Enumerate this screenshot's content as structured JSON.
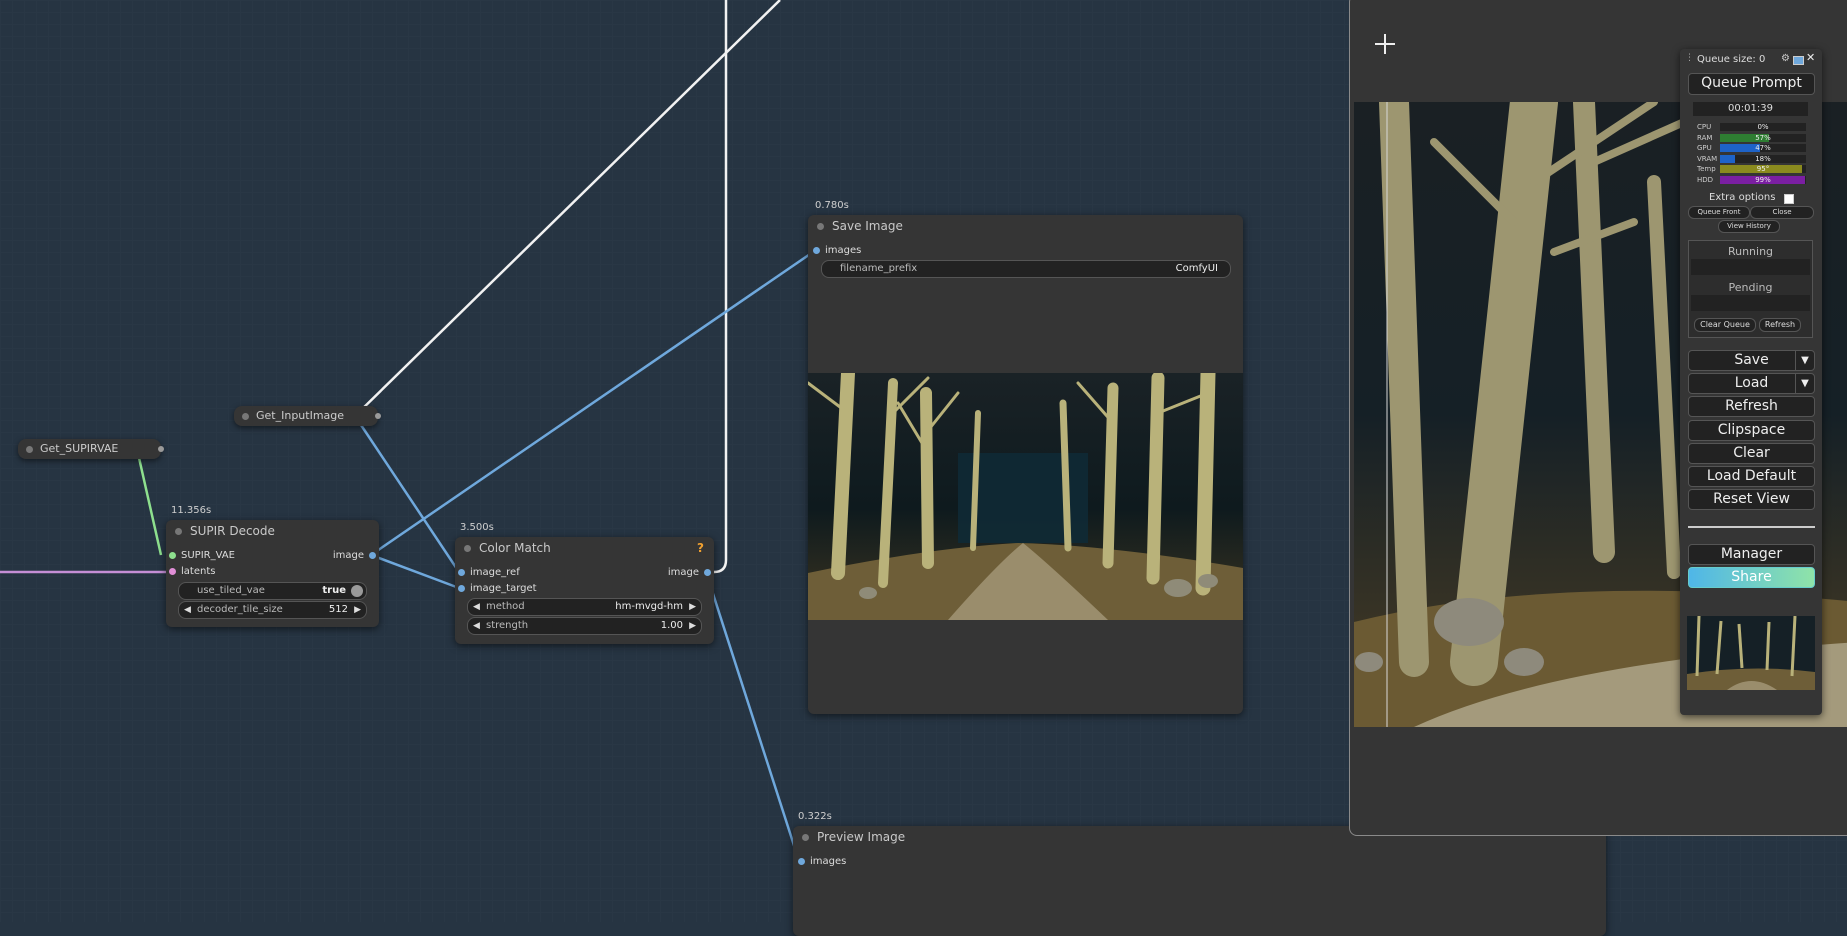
{
  "nodes": {
    "get_supirvae": {
      "title": "Get_SUPIRVAE"
    },
    "get_inputimage": {
      "title": "Get_InputImage"
    },
    "supir_decode": {
      "timing": "11.356s",
      "title": "SUPIR Decode",
      "inputs": [
        "SUPIR_VAE",
        "latents"
      ],
      "output": "image",
      "widgets": [
        {
          "label": "use_tiled_vae",
          "value": "true"
        },
        {
          "label": "decoder_tile_size",
          "value": "512"
        }
      ]
    },
    "color_match": {
      "timing": "3.500s",
      "title": "Color Match",
      "badge": "?",
      "inputs": [
        "image_ref",
        "image_target"
      ],
      "output": "image",
      "widgets": [
        {
          "label": "method",
          "value": "hm-mvgd-hm"
        },
        {
          "label": "strength",
          "value": "1.00"
        }
      ]
    },
    "save_image": {
      "timing": "0.780s",
      "title": "Save Image",
      "input": "images",
      "widget": {
        "label": "filename_prefix",
        "value": "ComfyUI"
      }
    },
    "preview_image": {
      "timing": "0.322s",
      "title": "Preview Image",
      "input": "images"
    }
  },
  "viewer": {
    "crosshair_icon": "crosshair-icon"
  },
  "panel": {
    "queue_size": "Queue size: 0",
    "queue_prompt": "Queue Prompt",
    "timer": "00:01:39",
    "monitors": [
      {
        "label": "CPU",
        "value": "0%",
        "fraction": 0.0,
        "color": "#2e7d32"
      },
      {
        "label": "RAM",
        "value": "57%",
        "fraction": 0.57,
        "color": "#2e7d32"
      },
      {
        "label": "GPU",
        "value": "47%",
        "fraction": 0.47,
        "color": "#1e63c8"
      },
      {
        "label": "VRAM",
        "value": "18%",
        "fraction": 0.18,
        "color": "#1e63c8"
      },
      {
        "label": "Temp",
        "value": "95°",
        "fraction": 0.95,
        "color": "#8a8a1e"
      },
      {
        "label": "HDD",
        "value": "99%",
        "fraction": 0.99,
        "color": "#7b1fa2"
      }
    ],
    "extra_options": "Extra options",
    "queue_front": "Queue Front",
    "close": "Close",
    "view_history": "View History",
    "running": "Running",
    "pending": "Pending",
    "clear_queue": "Clear Queue",
    "refresh_small": "Refresh",
    "save": "Save",
    "load": "Load",
    "refresh": "Refresh",
    "clipspace": "Clipspace",
    "clear": "Clear",
    "load_default": "Load Default",
    "reset_view": "Reset View",
    "manager": "Manager",
    "share": "Share"
  }
}
